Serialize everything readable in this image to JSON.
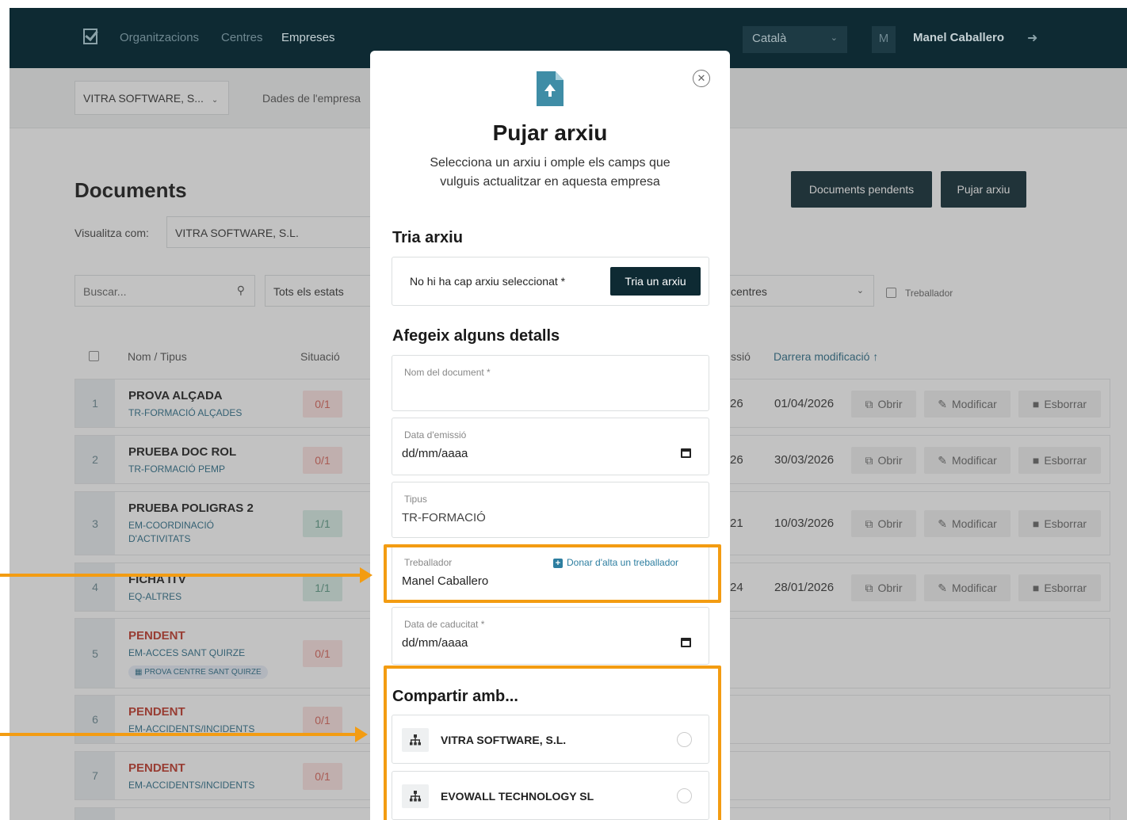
{
  "nav": {
    "links": [
      "Organitzacions",
      "Centres",
      "Empreses"
    ],
    "language": "Català",
    "user_initial": "M",
    "user_name": "Manel Caballero"
  },
  "subbar": {
    "company": "VITRA SOFTWARE, S...",
    "link": "Dades de l'empresa"
  },
  "page": {
    "title": "Documents",
    "btn_pending": "Documents pendents",
    "btn_upload": "Pujar arxiu",
    "view_as_label": "Visualitza com:",
    "view_as_value": "VITRA SOFTWARE, S.L."
  },
  "filters": {
    "search_placeholder": "Buscar...",
    "states": "Tots els estats",
    "centres": "centres",
    "worker_checkbox": "Treballador"
  },
  "table": {
    "headers": [
      "Nom / Tipus",
      "Situació",
      "ssió",
      "Darrera modificació"
    ],
    "rows": [
      {
        "num": "1",
        "title": "PROVA ALÇADA",
        "sub": "TR-FORMACIÓ ALÇADES",
        "sit": "0/1",
        "sit_status": "red",
        "date1": "26",
        "date2": "01/04/2026",
        "actions": true
      },
      {
        "num": "2",
        "title": "PRUEBA DOC ROL",
        "sub": "TR-FORMACIÓ PEMP",
        "sit": "0/1",
        "sit_status": "red",
        "date1": "26",
        "date2": "30/03/2026",
        "actions": true
      },
      {
        "num": "3",
        "title": "PRUEBA POLIGRAS 2",
        "sub": "EM-COORDINACIÓ D'ACTIVITATS",
        "sit": "1/1",
        "sit_status": "green",
        "date1": "21",
        "date2": "10/03/2026",
        "actions": true
      },
      {
        "num": "4",
        "title": "FICHA ITV",
        "sub": "EQ-ALTRES",
        "sit": "1/1",
        "sit_status": "green",
        "date1": "24",
        "date2": "28/01/2026",
        "actions": true
      },
      {
        "num": "5",
        "title": "PENDENT",
        "sub": "EM-ACCES SANT QUIRZE",
        "tag": "PROVA CENTRE SANT QUIRZE",
        "sit": "0/1",
        "sit_status": "red",
        "pending": true
      },
      {
        "num": "6",
        "title": "PENDENT",
        "sub": "EM-ACCIDENTS/INCIDENTS",
        "sit": "0/1",
        "sit_status": "red",
        "pending": true
      },
      {
        "num": "7",
        "title": "PENDENT",
        "sub": "EM-ACCIDENTS/INCIDENTS",
        "sit": "0/1",
        "sit_status": "red",
        "pending": true
      }
    ],
    "action_open": "Obrir",
    "action_edit": "Modificar",
    "action_delete": "Esborrar"
  },
  "modal": {
    "title": "Pujar arxiu",
    "description": "Selecciona un arxiu i omple els camps que vulguis actualitzar en aquesta empresa",
    "choose_section": "Tria arxiu",
    "no_file": "No hi ha cap arxiu seleccionat *",
    "choose_button": "Tria un arxiu",
    "details_section": "Afegeix alguns detalls",
    "fields": {
      "doc_name_label": "Nom del document *",
      "issue_date_label": "Data d'emissió",
      "issue_date_value": "dd/mm/aaaa",
      "type_label": "Tipus",
      "type_value": "TR-FORMACIÓ",
      "worker_label": "Treballador",
      "worker_add_link": "Donar d'alta un treballador",
      "worker_value": "Manel Caballero",
      "expiry_label": "Data de caducitat *",
      "expiry_value": "dd/mm/aaaa"
    },
    "share_section": "Compartir amb...",
    "share_items": [
      "VITRA SOFTWARE, S.L.",
      "EVOWALL TECHNOLOGY SL"
    ]
  },
  "colors": {
    "nav_bg": "#0e2a33",
    "highlight": "#f39c12",
    "link": "#2d7ea0"
  }
}
